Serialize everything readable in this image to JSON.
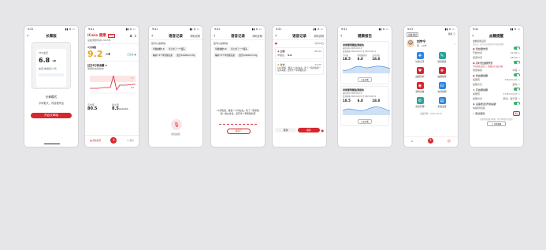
{
  "status": {
    "time": "9:41",
    "icons": "▮▮ ≋ ▭"
  },
  "s1": {
    "title": "长辈版",
    "card_title": "PPG血压",
    "value": "6.8",
    "bp": "血压/收缩压12天",
    "note1": "长辈模式",
    "note2": "字体更大，内容更简洁",
    "button": "开启长辈版"
  },
  "s2": {
    "brand": "iCare 健康",
    "brand_sub": "PPG",
    "device": "设备测量时间 2023年",
    "rate_label": "1分钟数",
    "value": "9.2",
    "arrow": "→",
    "status_badge": "已连接 ●",
    "chart_title": "过去5分钟血糖 ⊙",
    "chart_sub": "测量状态持续中",
    "m1": "平均值",
    "v1": "80.5",
    "m2": "最大值",
    "v2": "8.5",
    "m2u": "mmol/L",
    "tabs": [
      "健康监测",
      "我的"
    ],
    "tag1": "8.3",
    "tag2": "9.5"
  },
  "s3": {
    "title": "语音记录",
    "right": "帮助说明",
    "hint": "您可以这样说",
    "chips": [
      "早餐血糖5.8",
      "早上吃了一个馒头",
      "睡前7.5个单位胰岛素",
      "血压126/82mmHg"
    ],
    "mic_label": "按住说话"
  },
  "s4": {
    "title": "语音记录",
    "right": "帮助说明",
    "hint": "您可以这样说",
    "chips": [
      "早餐血糖5.8",
      "早上吃了一个馒头",
      "睡前7.5个单位胰岛素",
      "血压126/82mmHg"
    ],
    "listen": "12点吃饭，餐后一小时左右，吃了一碗米饭和一盘炒青菜，还有半个苹果和奶茶",
    "stop": "说完了"
  },
  "s5": {
    "title": "语音记录",
    "right": "帮助说明",
    "date": "5月30日",
    "r1_label": "血糖",
    "r1_time": "08:30",
    "r1_sub": "早餐后",
    "r1_val": "5.6",
    "r2_label": "饮食",
    "r2_time": "12:05",
    "r2_text": "12点吃饭，餐后一小时左右，吃了一碗米饭和一盘炒青菜，还有半个苹果和奶茶",
    "cancel": "取消",
    "save": "保存"
  },
  "s6": {
    "title": "健康报告",
    "rep1": "持续葡萄糖监测报告",
    "rep1_sub": "报告时间 2023-04-14",
    "rep1_sub2": "监测周期 2023-04-01 至 2023-04-14",
    "c1": "平均值",
    "c2": "葡萄糖管理",
    "c3": "变异系数",
    "v1": "18.5",
    "v2": "6.8",
    "v3": "18.8",
    "more": "点击查看",
    "rep2": "持续葡萄糖监测报告"
  },
  "s7": {
    "name": "刘宇宁",
    "sub": "男 · 32岁",
    "msg": "消息 ⓘ",
    "device": "设备连接",
    "grid": [
      {
        "icon": "✚",
        "label": "饮食记录",
        "color": "#2f86e0"
      },
      {
        "icon": "✎",
        "label": "健康报告",
        "color": "#2aa59a"
      },
      {
        "icon": "♥",
        "label": "血糖目标",
        "color": "#d8262e"
      },
      {
        "icon": "❖",
        "label": "血糖提醒",
        "color": "#d8262e"
      },
      {
        "icon": "◉",
        "label": "我的设备",
        "color": "#d8262e"
      },
      {
        "icon": "☊",
        "label": "在线客服",
        "color": "#2f86e0"
      },
      {
        "icon": "⚙",
        "label": "家庭管理",
        "color": "#2aa59a"
      },
      {
        "icon": "▤",
        "label": "系统设置",
        "color": "#2f86e0"
      }
    ],
    "footer": "设备管理 · 2021.08.15"
  },
  "s8": {
    "title": "血糖提醒",
    "sec1": "血糖提醒设置",
    "sec1_sub": "开启后，您可以在设置时间内收到提醒",
    "r1": "低血糖告警",
    "r1a": "开始时间",
    "r1a_v": "22:00 >",
    "r1b": "结束时间",
    "r1b_v": "08:00 >",
    "r2": "实时低血糖预警",
    "warn": "手机系统会显示，请确认开启此功能",
    "r2a": "预警等级",
    "r2a_v": "中度 >",
    "r3": "低血糖提醒",
    "r3a": "提醒值",
    "r3a_v": "3.9mmol/L >",
    "r3b": "提醒方式",
    "r3b_v": "震动 >",
    "r4": "高血糖提醒",
    "r4a": "提醒值",
    "r4a_v": "13.9mmol/L >",
    "r4b": "提醒方式",
    "r4b_v": "震动、提示音 >",
    "r5": "设备断连/异常提醒",
    "sec2": "特殊场景提醒",
    "r6": "测试通知",
    "r6_sub": "测试提醒能否正常接收",
    "r6_btn": "测试",
    "foot": "如需帮助请联系客服，我们将竭诚为您服务",
    "foot_btn": "□ 在线客服"
  },
  "colors": {
    "accent": "#d8262e",
    "toggle": "#3bb06c",
    "blue": "#2f86e0"
  }
}
